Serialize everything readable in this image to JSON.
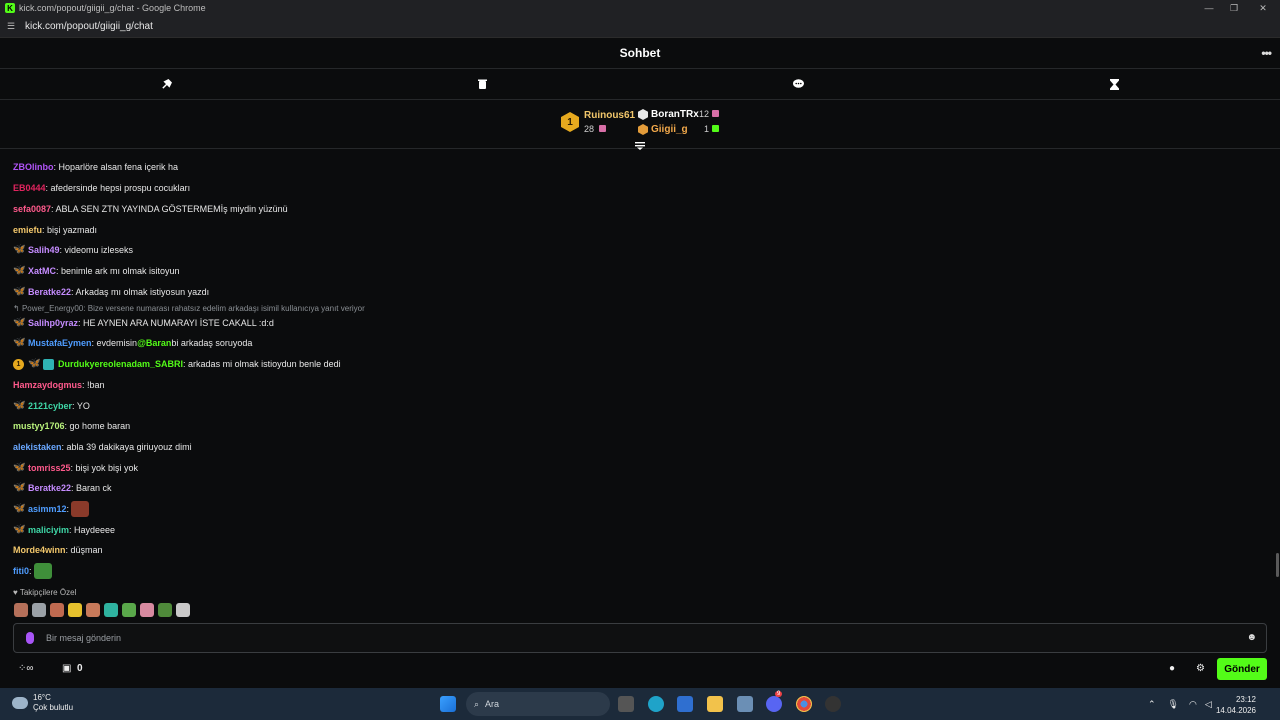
{
  "browser": {
    "window_title": "kick.com/popout/giigii_g/chat - Google Chrome",
    "url": "kick.com/popout/giigii_g/chat"
  },
  "header": {
    "title": "Sohbet",
    "menu_label": "•••"
  },
  "leaderboard": {
    "first": {
      "rank": "1",
      "name": "Ruinous61",
      "count": "28"
    },
    "second": {
      "name": "BoranTRx",
      "count": "12"
    },
    "third": {
      "name": "Giigii_g",
      "count": "1"
    }
  },
  "messages": [
    {
      "user": "ZBOlinbo",
      "color": "#b154f7",
      "text": ": Hoparlöre alsan fena içerik ha",
      "badges": []
    },
    {
      "user": "EB0444",
      "color": "#e0245e",
      "text": ": afedersinde hepsi prospu cocukları",
      "badges": []
    },
    {
      "user": "sefa0087",
      "color": "#ff5a8c",
      "text": ": ABLA SEN ZTN YAYINDA GÖSTERMEMİş miydin yüzünü",
      "badges": []
    },
    {
      "user": "emiefu",
      "color": "#f2c76b",
      "text": ": bişi yazmadı",
      "badges": []
    },
    {
      "user": "Salih49",
      "color": "#c58cff",
      "text": ": videomu izleseks",
      "badges": [
        "butterfly"
      ]
    },
    {
      "user": "XatMC",
      "color": "#c58cff",
      "text": ": benimle ark mı olmak isitoyun",
      "badges": [
        "butterfly"
      ]
    },
    {
      "user": "Beratke22",
      "color": "#c58cff",
      "text": ": Arkadaş mı olmak istiyosun yazdı",
      "badges": [
        "butterfly"
      ]
    },
    {
      "user": "Salihp0yraz",
      "color": "#c58cff",
      "text": ": HE AYNEN ARA NUMARAYI İSTE CAKALL :d:d",
      "badges": [
        "butterfly"
      ]
    },
    {
      "user": "MustafaEymen",
      "color": "#4f9dff",
      "text": ": evdemisin ",
      "mention": "@Baran",
      "text2": " bi arkadaş soruyoda",
      "badges": [
        "butterfly"
      ]
    },
    {
      "user": "Durdukyereolenadam_SABRI",
      "color": "#53fc18",
      "text": ": arkadas mi olmak istioydun benle dedi",
      "badges": [
        "round",
        "butterfly",
        "gift"
      ]
    },
    {
      "user": "Hamzaydogmus",
      "color": "#ff5a8c",
      "text": ": !ban",
      "badges": []
    },
    {
      "user": "2121cyber",
      "color": "#3fd7a7",
      "text": ": YO",
      "badges": [
        "butterfly"
      ]
    },
    {
      "user": "mustyy1706",
      "color": "#b9f27c",
      "text": ": go home baran",
      "badges": []
    },
    {
      "user": "alekistaken",
      "color": "#6aa8ff",
      "text": ": abla 39 dakikaya giriuyouz dimi",
      "badges": []
    },
    {
      "user": "tomriss25",
      "color": "#ff5a8c",
      "text": ": bişi yok bişi yok",
      "badges": [
        "butterfly-orange"
      ]
    },
    {
      "user": "Beratke22",
      "color": "#c58cff",
      "text": ": Baran ck",
      "badges": [
        "butterfly"
      ]
    },
    {
      "user": "asimm12",
      "color": "#4f9dff",
      "text": ":",
      "badges": [
        "butterfly-yellow"
      ],
      "emote": "#8a3a2a"
    },
    {
      "user": "maliciyim",
      "color": "#3fd7a7",
      "text": ": Haydeeee",
      "badges": [
        "butterfly"
      ]
    },
    {
      "user": "Morde4winn",
      "color": "#f2c76b",
      "text": ": düşman",
      "badges": []
    },
    {
      "user": "fiti0",
      "color": "#4f9dff",
      "text": ":",
      "badges": [],
      "emote": "#3f8f3a"
    }
  ],
  "reply_hint": "Power_Energy00: Bize versene numarası rahatsız edelim arkadaşı isimil kullanıcıya yanıt veriyor",
  "followers_label": "Takipçilere Özel",
  "followers_emotes": [
    "#b5705a",
    "#9aa0a6",
    "#c06a50",
    "#e6c12d",
    "#c87a5a",
    "#2fb3a0",
    "#5aa84a",
    "#d88aa0",
    "#4f8a3a",
    "#c9c9c9"
  ],
  "composer": {
    "placeholder": "Bir mesaj gönderin"
  },
  "bottombar": {
    "points_value": "0",
    "send_label": "Gönder"
  },
  "taskbar": {
    "temperature": "16°C",
    "weather": "Çok bulutlu",
    "search_placeholder": "Ara",
    "time": "23:12",
    "date": "14.04.2026",
    "discord_badge": "9"
  }
}
